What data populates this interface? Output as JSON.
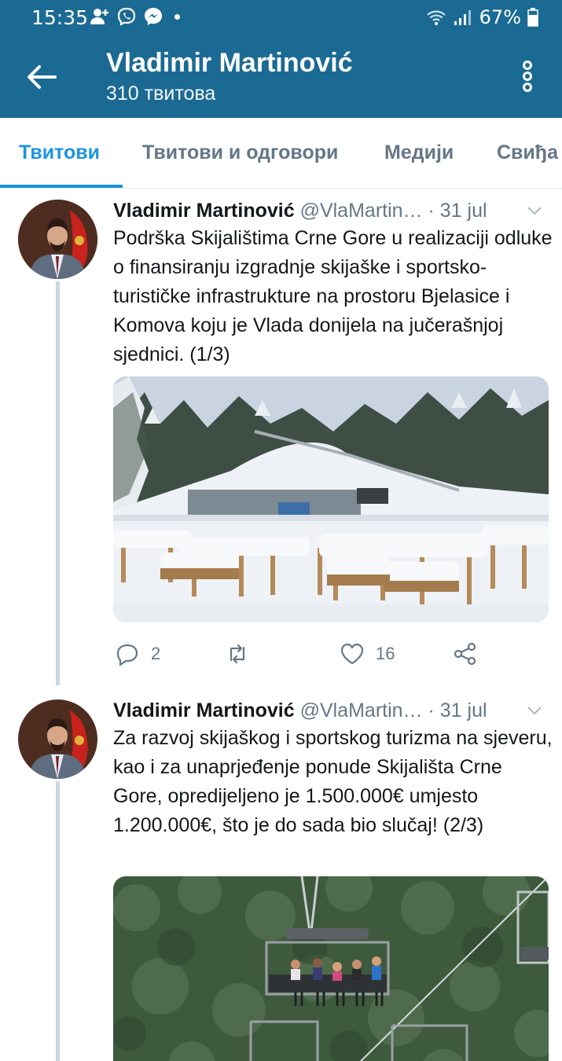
{
  "status": {
    "time": "15:35",
    "battery": "67%",
    "left_icons": [
      "person-add-icon",
      "viber-icon",
      "messenger-icon",
      "notification-dot"
    ],
    "right_icons": [
      "wifi-icon",
      "signal-icon",
      "battery-icon"
    ]
  },
  "header": {
    "name": "Vladimir Martinović",
    "subtitle": "310 твитова",
    "back_icon": "arrow-left-icon",
    "menu_icon": "more-vertical-icon"
  },
  "tabs": [
    {
      "label": "Твитови",
      "active": true
    },
    {
      "label": "Твитови и одговори",
      "active": false
    },
    {
      "label": "Медији",
      "active": false
    },
    {
      "label": "Свиђа",
      "active": false
    }
  ],
  "tweets": [
    {
      "name": "Vladimir Martinović",
      "handle": "@VlaMartin…",
      "date": "· 31 jul",
      "text": "Podrška Skijalištima Crne Gore u realizaciji odluke o finansiranju izgradnje skijaške i sportsko-turističke infrastrukture na prostoru Bjelasice i Komova koju je Vlada donijela na jučerašnjoj sjednici. (1/3)",
      "media": "snowy-ski-resort-photo",
      "replies": "2",
      "retweets": "",
      "likes": "16"
    },
    {
      "name": "Vladimir Martinović",
      "handle": "@VlaMartin…",
      "date": "· 31 jul",
      "text": "Za razvoj skijaškog i sportskog turizma na sjeveru, kao i za unaprjeđenje ponude Skijališta Crne Gore, opredijeljeno je 1.500.000€ umjesto 1.200.000€, što je do sada bio slučaj! (2/3)",
      "media": "chairlift-photo"
    }
  ],
  "colors": {
    "header_bg": "#1b6a94",
    "accent": "#1b95e0",
    "secondary_text": "#657786"
  }
}
